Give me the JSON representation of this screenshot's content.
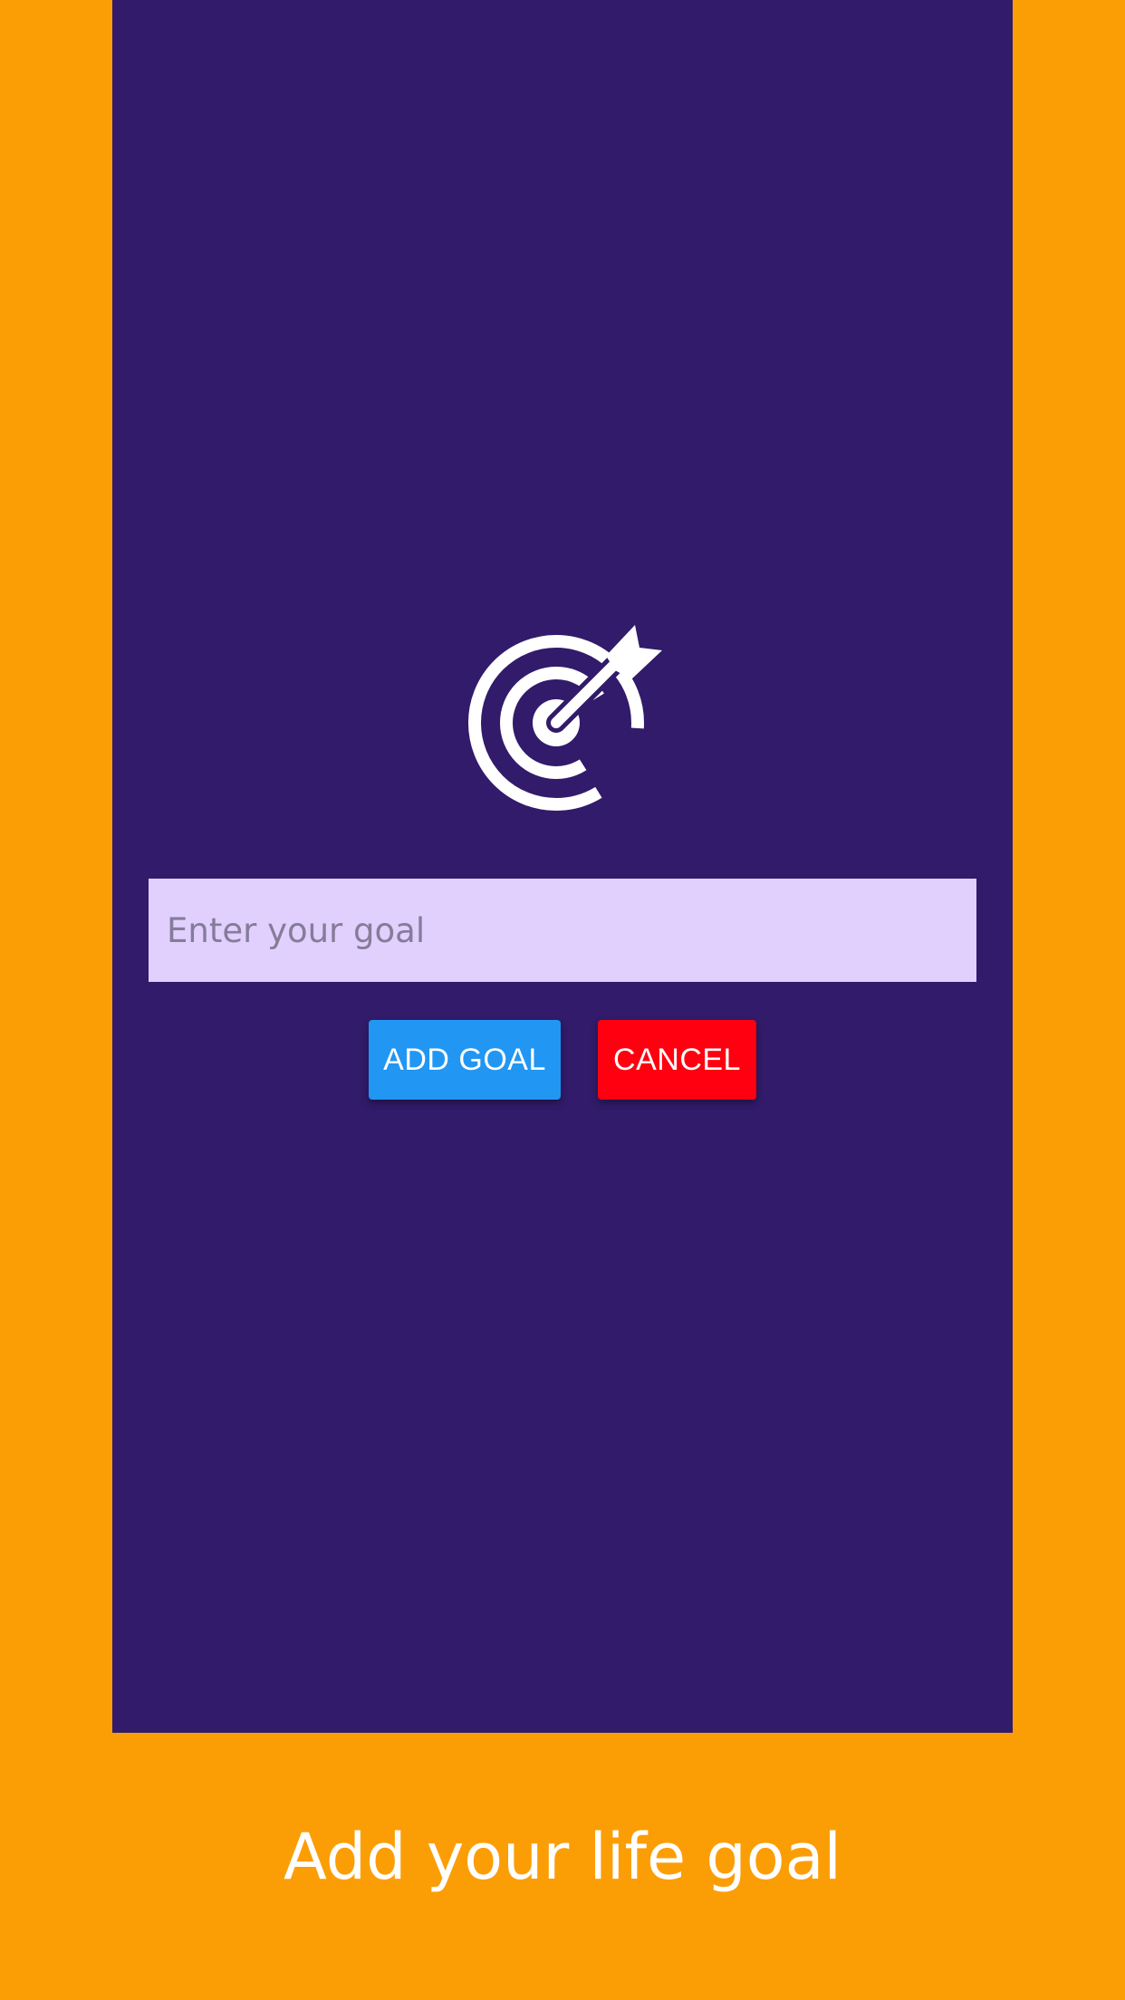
{
  "colors": {
    "frame_background": "#fb9e06",
    "screen_background": "#311b6a",
    "input_background": "#e1cffd",
    "add_button": "#2196f3",
    "cancel_button": "#ff0010"
  },
  "screen": {
    "icon": "target-goal-icon",
    "goal_input": {
      "value": "",
      "placeholder": "Enter your goal"
    },
    "add_button_label": "ADD GOAL",
    "cancel_button_label": "CANCEL"
  },
  "caption": "Add your life goal"
}
